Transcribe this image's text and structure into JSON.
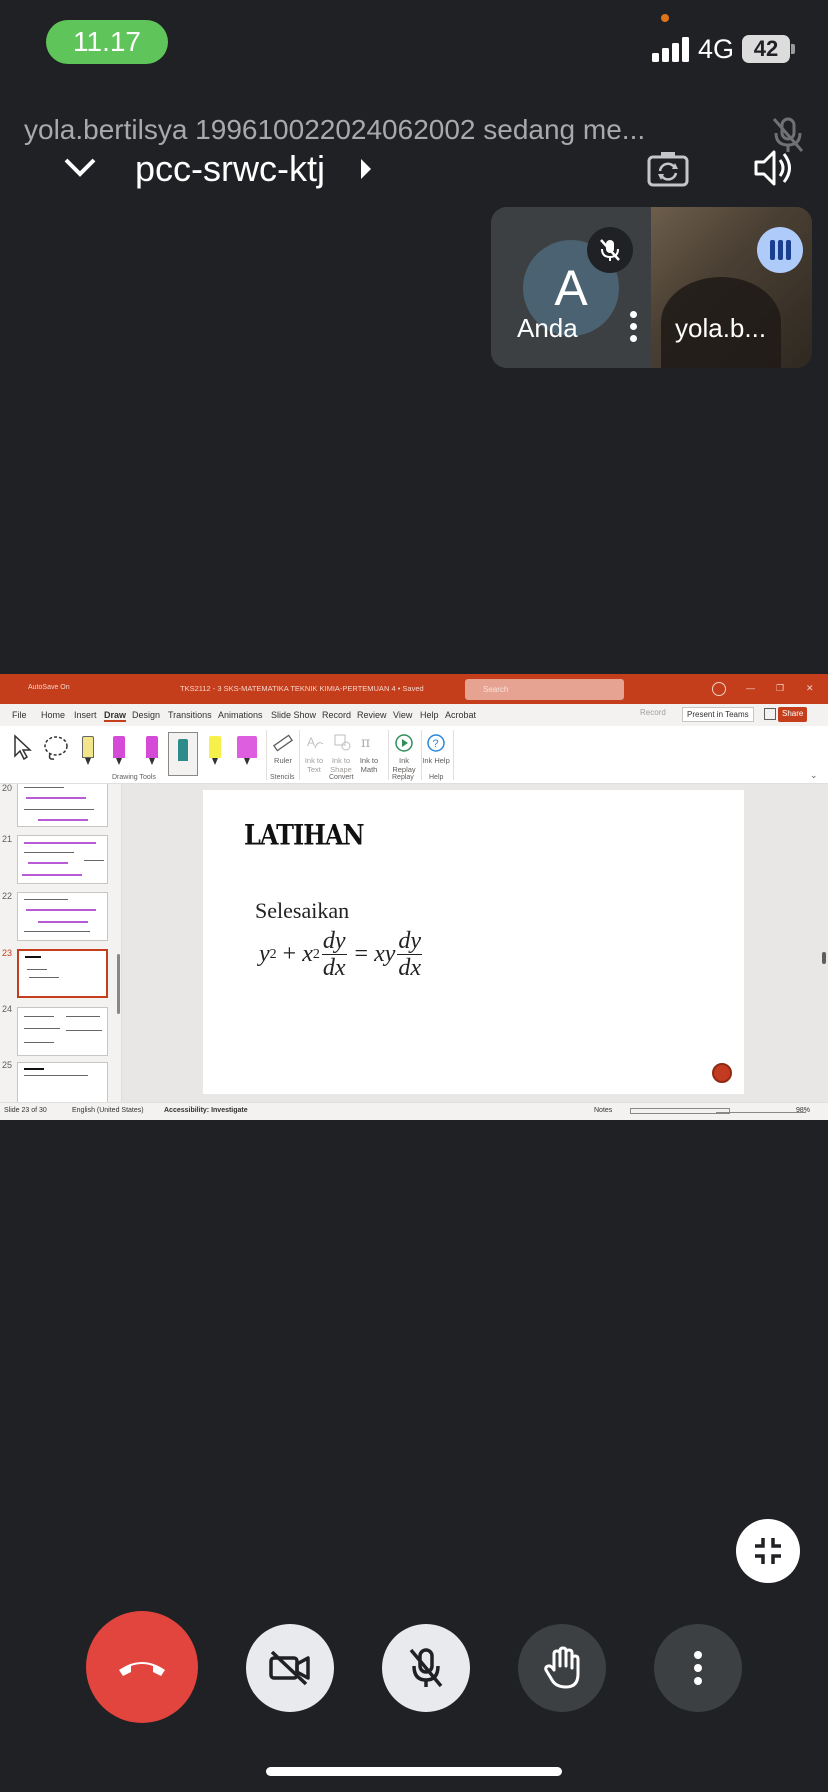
{
  "status_bar": {
    "time": "11.17",
    "network": "4G",
    "battery": "42"
  },
  "meeting": {
    "presenting_banner": "yola.bertilsya 199610022024062002 sedang me...",
    "code": "pcc-srwc-ktj"
  },
  "participants": [
    {
      "initial": "A",
      "name": "Anda",
      "muted": true
    },
    {
      "name": "yola.b...",
      "speaking": true
    }
  ],
  "powerpoint": {
    "autosave": "AutoSave  On",
    "document_title": "TKS2112 - 3 SKS-MATEMATIKA TEKNIK KIMIA-PERTEMUAN 4 • Saved",
    "search_placeholder": "Search",
    "menu": [
      "File",
      "Home",
      "Insert",
      "Draw",
      "Design",
      "Transitions",
      "Animations",
      "Slide Show",
      "Record",
      "Review",
      "View",
      "Help",
      "Acrobat"
    ],
    "active_tab": "Draw",
    "record_label": "Record",
    "present_label": "Present in Teams",
    "share_label": "Share",
    "ribbon": {
      "ruler": "Ruler",
      "ink_to_text": "Ink to Text",
      "ink_to_shape": "Ink to Shape",
      "ink_to_math": "Ink to Math",
      "ink_replay": "Ink Replay",
      "ink_help": "Ink Help",
      "groups": {
        "drawing_tools": "Drawing Tools",
        "stencils": "Stencils",
        "convert": "Convert",
        "replay": "Replay",
        "help": "Help"
      }
    },
    "thumbnails": [
      "20",
      "21",
      "22",
      "23",
      "24",
      "25"
    ],
    "selected_slide": "23",
    "slide": {
      "title": "LATIHAN",
      "subtitle": "Selesaikan",
      "equation": {
        "y_base": "y",
        "y_exp": "2",
        "plus": "+",
        "x_base": "x",
        "x_exp": "2",
        "frac_num": "dy",
        "frac_den": "dx",
        "equals": "=",
        "rhs": "xy"
      }
    },
    "status": {
      "slide_count": "Slide 23 of 30",
      "language": "English (United States)",
      "accessibility": "Accessibility: Investigate",
      "notes": "Notes",
      "zoom": "98%"
    }
  },
  "colors": {
    "ppt_brand": "#c43e1c",
    "end_call": "#e1453d",
    "time_pill": "#5fc55a",
    "speaking": "#aecbfa"
  }
}
